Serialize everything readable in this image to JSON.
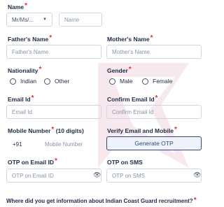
{
  "fields": {
    "name": {
      "label": "Name",
      "required": "*",
      "title_select": "Mr/Ms/...",
      "placeholder": "Name"
    },
    "fathers_name": {
      "label": "Father's Name",
      "required": "*",
      "placeholder": "Father's Name"
    },
    "mothers_name": {
      "label": "Mother's Name",
      "required": "*",
      "placeholder": "Mother's Name"
    },
    "nationality": {
      "label": "Nationality",
      "required": "*",
      "options": [
        "Indian",
        "Other"
      ]
    },
    "gender": {
      "label": "Gender",
      "required": "*",
      "options": [
        "Male",
        "Female"
      ]
    },
    "email": {
      "label": "Email Id",
      "required": "*",
      "placeholder": "Email Id"
    },
    "confirm_email": {
      "label": "Confirm Email Id",
      "required": "*",
      "placeholder": "Confirm Email Id"
    },
    "mobile": {
      "label": "Mobile Number",
      "required": "*",
      "hint": "(10 digits)",
      "country_code": "+91",
      "placeholder": "Mobile Number"
    },
    "verify": {
      "label": "Verify Email and Mobile",
      "required": "*",
      "button": "Generate OTP"
    },
    "otp_email": {
      "label": "OTP on Email ID",
      "required": "*",
      "placeholder": "OTP on Email ID"
    },
    "otp_sms": {
      "label": "OTP on SMS",
      "placeholder": "OTP on SMS"
    },
    "source": {
      "label": "Where did you get information about Indian Coast Guard recruitment?",
      "required": "*"
    }
  },
  "colors": {
    "required": "#e0322f",
    "text": "#1f2a44",
    "border": "#cfd6e3"
  },
  "icons": {
    "password_toggle": "eye-icon",
    "select": "chevron-down-icon"
  }
}
